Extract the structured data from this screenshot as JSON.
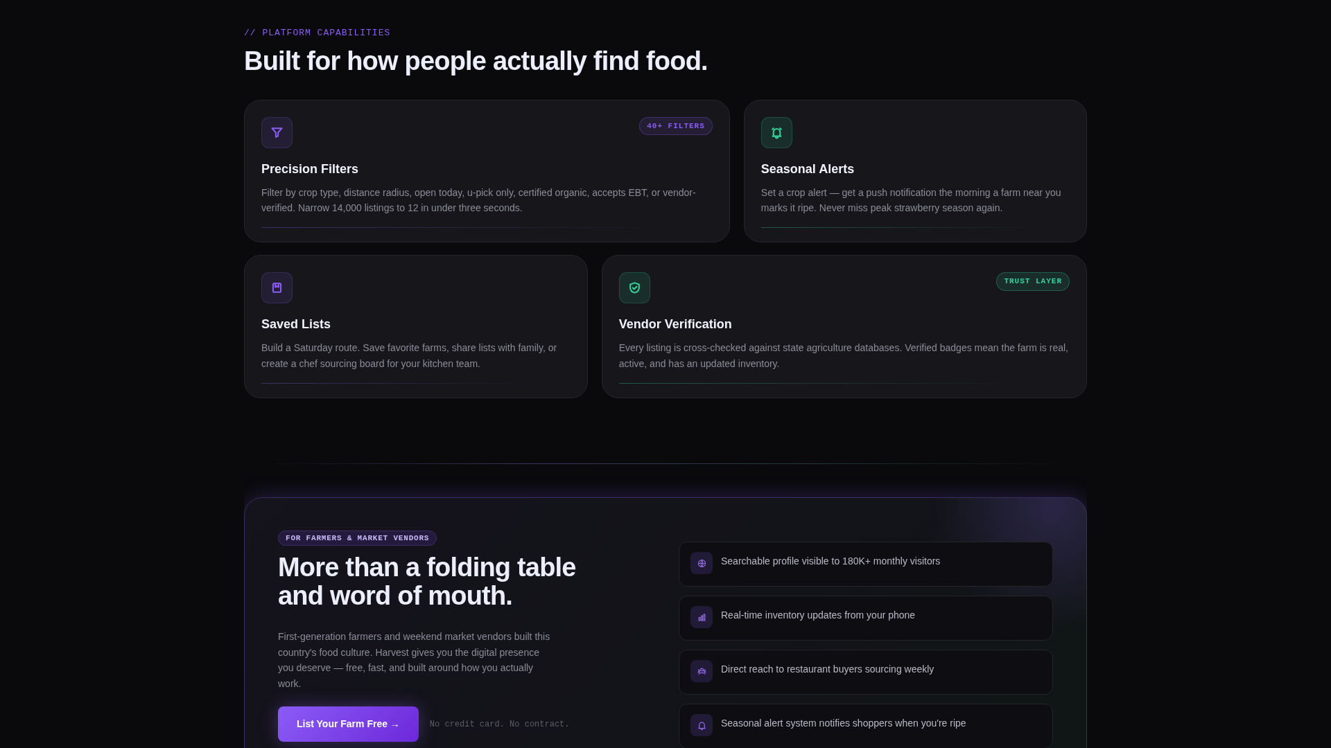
{
  "section": {
    "eyebrow": "// PLATFORM CAPABILITIES",
    "title": "Built for how people actually find food."
  },
  "features": [
    {
      "title": "Precision Filters",
      "text": "Filter by crop type, distance radius, open today, u-pick only, certified organic, accepts EBT, or vendor-verified. Narrow 14,000 listings to 12 in under three seconds.",
      "badge": "40+ FILTERS",
      "color": "#8b5cf6"
    },
    {
      "title": "Seasonal Alerts",
      "text": "Set a crop alert — get a push notification the morning a farm near you marks it ripe. Never miss peak strawberry season again.",
      "color": "#34d399"
    },
    {
      "title": "Saved Lists",
      "text": "Build a Saturday route. Save favorite farms, share lists with family, or create a chef sourcing board for your kitchen team.",
      "color": "#8b5cf6"
    },
    {
      "title": "Vendor Verification",
      "text": "Every listing is cross-checked against state agriculture databases. Verified badges mean the farm is real, active, and has an updated inventory.",
      "badge": "TRUST LAYER",
      "color": "#34d399"
    }
  ],
  "vendors": {
    "badge": "FOR FARMERS & MARKET VENDORS",
    "title": "More than a folding table and word of mouth.",
    "text": "First-generation farmers and weekend market vendors built this country's food culture. Harvest gives you the digital presence you deserve — free, fast, and built around how you actually work.",
    "button": "List Your Farm Free →",
    "note": "No credit card. No contract.",
    "benefits": [
      "Searchable profile visible to 180K+ monthly visitors",
      "Real-time inventory updates from your phone",
      "Direct reach to restaurant buyers sourcing weekly",
      "Seasonal alert system notifies shoppers when you're ripe"
    ]
  }
}
